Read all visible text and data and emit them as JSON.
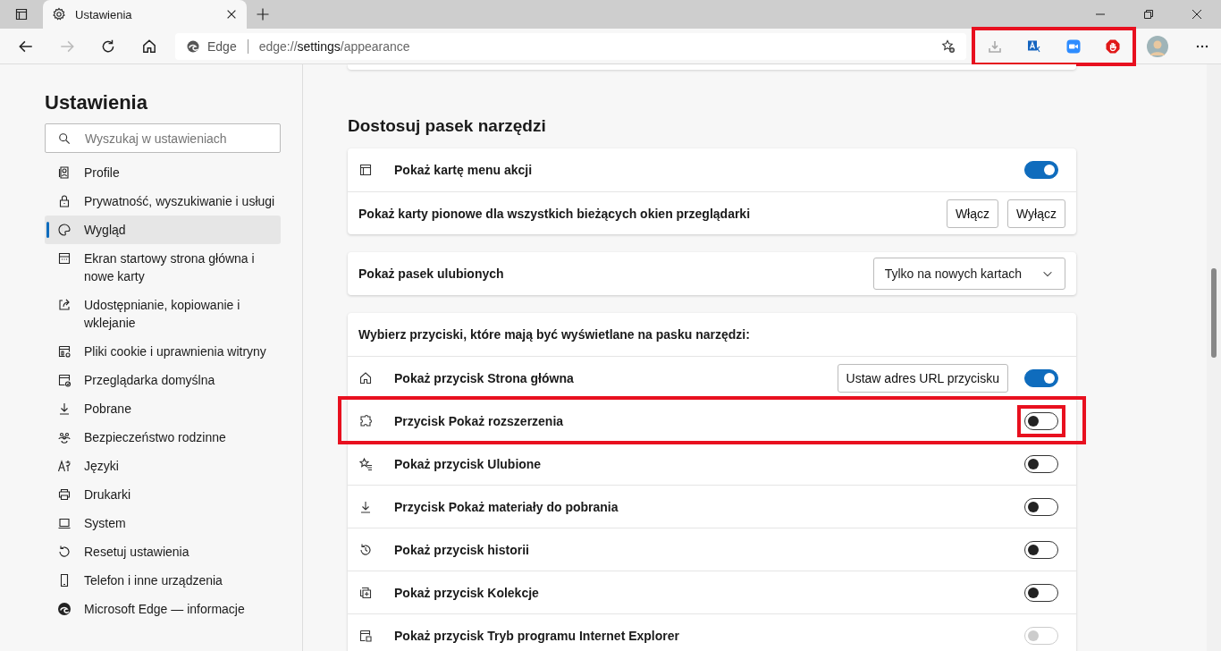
{
  "browser": {
    "tab": {
      "title": "Ustawienia"
    },
    "address": {
      "site_label": "Edge",
      "url_prefix": "edge://",
      "url_host": "settings",
      "url_path": "/appearance"
    },
    "extensions_highlighted": true
  },
  "sidebar": {
    "title": "Ustawienia",
    "search": {
      "placeholder": "Wyszukaj w ustawieniach"
    },
    "items": [
      {
        "label": "Profile",
        "selected": false
      },
      {
        "label": "Prywatność, wyszukiwanie i usługi",
        "selected": false
      },
      {
        "label": "Wygląd",
        "selected": true
      },
      {
        "label": "Ekran startowy strona główna i nowe karty",
        "selected": false
      },
      {
        "label": "Udostępnianie, kopiowanie i wklejanie",
        "selected": false
      },
      {
        "label": "Pliki cookie i uprawnienia witryny",
        "selected": false
      },
      {
        "label": "Przeglądarka domyślna",
        "selected": false
      },
      {
        "label": "Pobrane",
        "selected": false
      },
      {
        "label": "Bezpieczeństwo rodzinne",
        "selected": false
      },
      {
        "label": "Języki",
        "selected": false
      },
      {
        "label": "Drukarki",
        "selected": false
      },
      {
        "label": "System",
        "selected": false
      },
      {
        "label": "Resetuj ustawienia",
        "selected": false
      },
      {
        "label": "Telefon i inne urządzenia",
        "selected": false
      },
      {
        "label": "Microsoft Edge — informacje",
        "selected": false
      }
    ]
  },
  "section": {
    "title": "Dostosuj pasek narzędzi"
  },
  "cards": [
    {
      "rows": [
        {
          "kind": "toggle",
          "label": "Pokaż kartę menu akcji",
          "on": true,
          "disabled": false,
          "highlighted": false
        },
        {
          "kind": "buttons",
          "label": "Pokaż karty pionowe dla wszystkich bieżących okien przeglądarki",
          "buttons": [
            "Włącz",
            "Wyłącz"
          ]
        }
      ]
    },
    {
      "rows": [
        {
          "kind": "dropdown",
          "label": "Pokaż pasek ulubionych",
          "value": "Tylko na nowych kartach"
        }
      ]
    },
    {
      "header": "Wybierz przyciski, które mają być wyświetlane na pasku narzędzi:",
      "rows": [
        {
          "kind": "toggle",
          "label": "Pokaż przycisk Strona główna",
          "action_button": "Ustaw adres URL przycisku",
          "on": true,
          "disabled": false,
          "highlighted": false
        },
        {
          "kind": "toggle",
          "label": "Przycisk Pokaż rozszerzenia",
          "on": false,
          "disabled": false,
          "highlighted": true
        },
        {
          "kind": "toggle",
          "label": "Pokaż przycisk Ulubione",
          "on": false,
          "disabled": false,
          "highlighted": false
        },
        {
          "kind": "toggle",
          "label": "Przycisk Pokaż materiały do pobrania",
          "on": false,
          "disabled": false,
          "highlighted": false
        },
        {
          "kind": "toggle",
          "label": "Pokaż przycisk historii",
          "on": false,
          "disabled": false,
          "highlighted": false
        },
        {
          "kind": "toggle",
          "label": "Pokaż przycisk Kolekcje",
          "on": false,
          "disabled": false,
          "highlighted": false
        },
        {
          "kind": "toggle",
          "label": "Pokaż przycisk Tryb programu Internet Explorer",
          "on": false,
          "disabled": true,
          "highlighted": false
        }
      ]
    }
  ]
}
